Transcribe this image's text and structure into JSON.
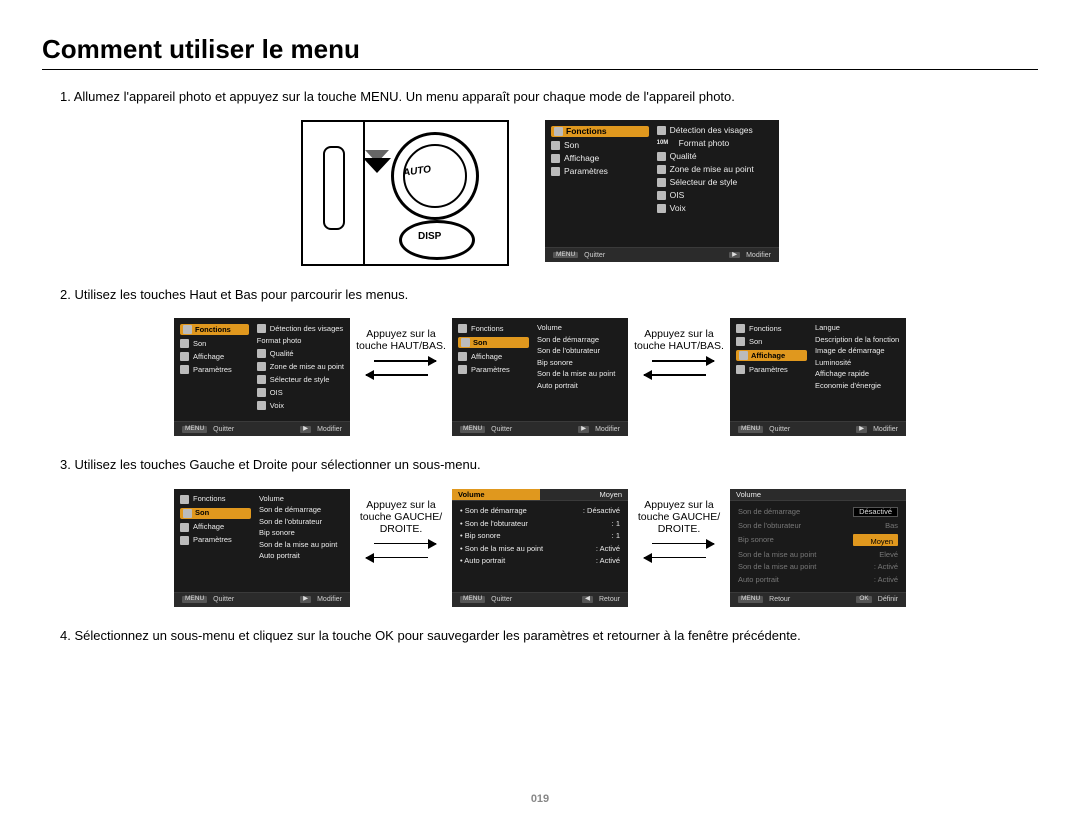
{
  "title": "Comment utiliser le menu",
  "page_number": "019",
  "steps": {
    "s1": "1. Allumez l'appareil photo et appuyez sur la touche MENU.  Un menu apparaît pour chaque mode de l'appareil photo.",
    "s2": "2. Utilisez les touches Haut et Bas pour parcourir les menus.",
    "s3": "3. Utilisez les touches Gauche et Droite pour sélectionner un sous-menu.",
    "s4": "4. Sélectionnez un sous-menu et cliquez sur la touche OK pour sauvegarder les paramètres et retourner à la fenêtre précédente."
  },
  "conn": {
    "updown": "Appuyez sur la touche HAUT/BAS.",
    "leftright": "Appuyez sur la touche GAUCHE/ DROITE."
  },
  "menu_left": {
    "fonctions": "Fonctions",
    "son": "Son",
    "affichage": "Affichage",
    "parametres": "Paramètres"
  },
  "menu_right_fonctions": {
    "r1": "Détection des visages",
    "r2": "Format photo",
    "r3": "Qualité",
    "r4": "Zone de mise au point",
    "r5": "Sélecteur de style",
    "r6": "OIS",
    "r7": "Voix"
  },
  "menu_right_son": {
    "r1": "Volume",
    "r2": "Son de démarrage",
    "r3": "Son de l'obturateur",
    "r4": "Bip sonore",
    "r5": "Son de la mise au point",
    "r6": "Auto portrait"
  },
  "menu_right_affichage": {
    "r1": "Langue",
    "r2": "Description de la fonction",
    "r3": "Image de démarrage",
    "r4": "Luminosité",
    "r5": "Affichage rapide",
    "r6": "Economie d'énergie"
  },
  "footer": {
    "menu": "MENU",
    "quitter": "Quitter",
    "modifier": "Modifier",
    "retour": "Retour",
    "definir": "Définir",
    "ok": "OK"
  },
  "screenC1": {
    "header_l": "Volume",
    "header_r": "Moyen",
    "rows": [
      {
        "k": "Son de démarrage",
        "v": ": Désactivé"
      },
      {
        "k": "Son de l'obturateur",
        "v": ": 1"
      },
      {
        "k": "Bip sonore",
        "v": ": 1"
      },
      {
        "k": "Son de la mise au point",
        "v": ": Activé"
      },
      {
        "k": "Auto portrait",
        "v": ": Activé"
      }
    ]
  },
  "screenC2": {
    "header_l": "Volume",
    "rows": [
      {
        "k": "Son de démarrage",
        "v": "Désactivé"
      },
      {
        "k": "Son de l'obturateur",
        "v": "Bas"
      },
      {
        "k": "Bip sonore",
        "v": "Moyen",
        "hi": true
      },
      {
        "k": "Son de la mise au point",
        "v": "Elevé"
      },
      {
        "k": "Auto portrait",
        "v": ""
      }
    ],
    "extra": [
      {
        "k": "Son de la mise au point",
        "v": ": Activé"
      },
      {
        "k": "Auto portrait",
        "v": ": Activé"
      }
    ]
  },
  "icon_labels": {
    "r2_fmt": "10M"
  }
}
